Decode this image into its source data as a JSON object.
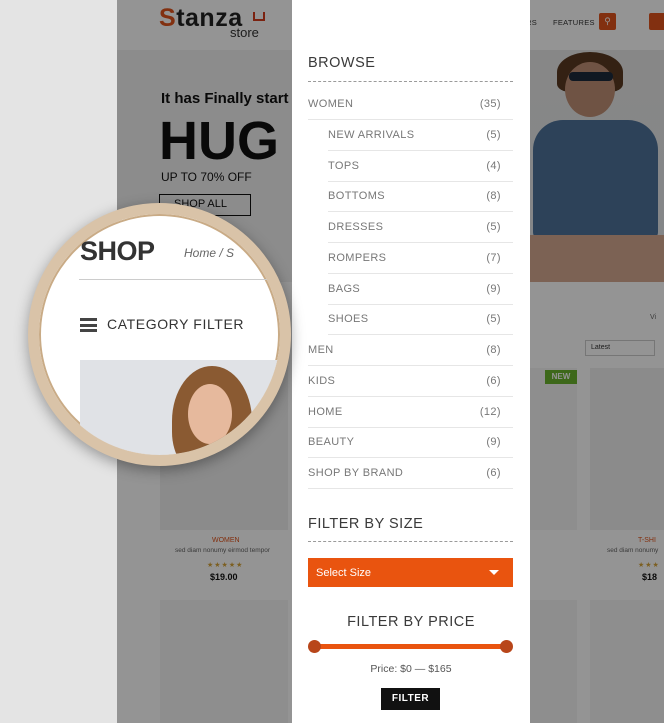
{
  "store": {
    "logo_s": "S",
    "logo_rest": "tanza",
    "logo_sub": "store"
  },
  "bg_nav": {
    "item1": "RS",
    "item2": "FEATURES",
    "search_icon": "search-icon"
  },
  "hero": {
    "line1": "It has Finally start",
    "huge": "HUG",
    "sub": "UP TO 70% OFF",
    "button": "SHOP ALL"
  },
  "shop_zoom": {
    "title": "SHOP",
    "breadcrumb": "Home / S",
    "filter_label": "CATEGORY FILTER",
    "filter_icon": "hamburger-icon"
  },
  "sort": {
    "selected": "Latest",
    "view_label": "Vi"
  },
  "products": [
    {
      "category": "WOMEN",
      "name": "sed diam nonumy eirmod tempor",
      "stars": "★★★★★",
      "price": "$19.00"
    },
    {
      "category": "T-SHI",
      "name": "sed diam nonumy",
      "stars": "★★★",
      "price": "$18"
    }
  ],
  "badge_new": "NEW",
  "sidebar": {
    "browse_title": "BROWSE",
    "categories": [
      {
        "label": "WOMEN",
        "count": "(35)",
        "indent": false
      },
      {
        "label": "NEW ARRIVALS",
        "count": "(5)",
        "indent": true
      },
      {
        "label": "TOPS",
        "count": "(4)",
        "indent": true
      },
      {
        "label": "BOTTOMS",
        "count": "(8)",
        "indent": true
      },
      {
        "label": "DRESSES",
        "count": "(5)",
        "indent": true
      },
      {
        "label": "ROMPERS",
        "count": "(7)",
        "indent": true
      },
      {
        "label": "BAGS",
        "count": "(9)",
        "indent": true
      },
      {
        "label": "SHOES",
        "count": "(5)",
        "indent": true
      },
      {
        "label": "MEN",
        "count": "(8)",
        "indent": false
      },
      {
        "label": "KIDS",
        "count": "(6)",
        "indent": false
      },
      {
        "label": "HOME",
        "count": "(12)",
        "indent": false
      },
      {
        "label": "BEAUTY",
        "count": "(9)",
        "indent": false
      },
      {
        "label": "SHOP BY BRAND",
        "count": "(6)",
        "indent": false
      }
    ],
    "size_title": "FILTER BY SIZE",
    "size_select": "Select Size",
    "price_title": "FILTER BY PRICE",
    "price_range": "Price: $0 — $165",
    "filter_button": "FILTER"
  },
  "colors": {
    "accent": "#e9540f",
    "new_badge": "#6ab42d",
    "frame": "#d9c3a8"
  }
}
